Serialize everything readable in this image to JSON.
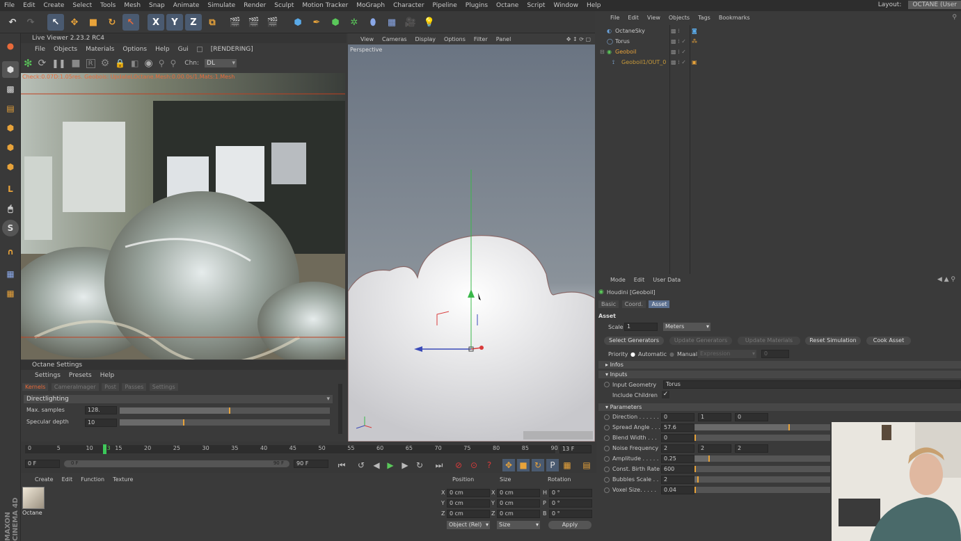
{
  "menu": [
    "File",
    "Edit",
    "Create",
    "Select",
    "Tools",
    "Mesh",
    "Snap",
    "Animate",
    "Simulate",
    "Render",
    "Sculpt",
    "Motion Tracker",
    "MoGraph",
    "Character",
    "Pipeline",
    "Plugins",
    "Octane",
    "Script",
    "Window",
    "Help"
  ],
  "layout": {
    "label": "Layout:",
    "value": "OCTANE (User"
  },
  "live_viewer": {
    "title": "Live Viewer 2.23.2 RC4",
    "menu": [
      "File",
      "Objects",
      "Materials",
      "Options",
      "Help",
      "Gui"
    ],
    "status": "[RENDERING]",
    "chn_label": "Chn:",
    "chn_value": "DL",
    "check_text": "Check:0.07D:1.05res. Geobois: UpdateLOctane.Mesh:0.00.0s/1.Mats:1.Mesh"
  },
  "octane_settings": {
    "title": "Octane Settings",
    "menu": [
      "Settings",
      "Presets",
      "Help"
    ],
    "tabs": [
      "Kernels",
      "CameraImager",
      "Post",
      "Passes",
      "Settings"
    ],
    "kernel": "Directlighting",
    "params": [
      {
        "label": "Max. samples",
        "value": "128.",
        "fill": 0.52
      },
      {
        "label": "Specular depth",
        "value": "10",
        "fill": 0.3
      }
    ]
  },
  "viewport": {
    "menu": [
      "View",
      "Cameras",
      "Display",
      "Options",
      "Filter",
      "Panel"
    ],
    "label": "Perspective"
  },
  "objects": {
    "menu": [
      "File",
      "Edit",
      "View",
      "Objects",
      "Tags",
      "Bookmarks"
    ],
    "rows": [
      {
        "name": "OctaneSky",
        "color": "#c8c8c8"
      },
      {
        "name": "Torus",
        "color": "#c8c8c8"
      },
      {
        "name": "Geoboil",
        "color": "#e8a33a"
      },
      {
        "name": "Geoboil1/OUT_0",
        "color": "#c89a3a"
      }
    ]
  },
  "attributes": {
    "menu": [
      "Mode",
      "Edit",
      "User Data"
    ],
    "title": "Houdini [Geoboil]",
    "tabs": [
      "Basic",
      "Coord.",
      "Asset"
    ],
    "section": "Asset",
    "scale_label": "Scale",
    "scale_value": "1",
    "unit": "Meters",
    "buttons": [
      "Select Generators",
      "Update Generators",
      "Update Materials",
      "Reset Simulation",
      "Cook Asset"
    ],
    "priority_label": "Priority",
    "priority_auto": "Automatic",
    "priority_manual": "Manual",
    "priority_expr": "Expression",
    "priority_num": "0",
    "infos": "Infos",
    "inputs": "Inputs",
    "input_geometry_label": "Input Geometry",
    "input_geometry_value": "Torus",
    "include_children": "Include Children",
    "parameters": "Parameters",
    "params": [
      {
        "label": "Direction . . . . . .",
        "values": [
          "0",
          "1",
          "0"
        ]
      },
      {
        "label": "Spread Angle . . .",
        "values": [
          "57.6"
        ],
        "fill": 0.69
      },
      {
        "label": "Blend Width . . .",
        "values": [
          "0"
        ],
        "fill": 0
      },
      {
        "label": "Noise Frequency",
        "values": [
          "2",
          "2",
          "2"
        ]
      },
      {
        "label": "Amplitude . . . . .",
        "values": [
          "0.25"
        ],
        "fill": 0.1
      },
      {
        "label": "Const. Birth Rate",
        "values": [
          "600"
        ],
        "fill": 0
      },
      {
        "label": "Bubbles Scale . .",
        "values": [
          "2"
        ],
        "fill": 0.02
      },
      {
        "label": "Voxel Size. . . . .",
        "values": [
          "0.04"
        ],
        "fill": 0
      }
    ]
  },
  "timeline": {
    "ticks": [
      "0",
      "5",
      "10",
      "13",
      "15",
      "20",
      "25",
      "30",
      "35",
      "40",
      "45",
      "50",
      "55",
      "60",
      "65",
      "70",
      "75",
      "80",
      "85",
      "90"
    ],
    "frame": "13 F",
    "start": "0 F",
    "range_start": "0 F",
    "range_end": "90 F",
    "end": "90 F"
  },
  "materials": {
    "menu": [
      "Create",
      "Edit",
      "Function",
      "Texture"
    ],
    "item": "Octane"
  },
  "coords": {
    "headers": [
      "Position",
      "Size",
      "Rotation"
    ],
    "rows": [
      {
        "a": "X",
        "pos": "0 cm",
        "b": "X",
        "size": "0 cm",
        "c": "H",
        "rot": "0 °"
      },
      {
        "a": "Y",
        "pos": "0 cm",
        "b": "Y",
        "size": "0 cm",
        "c": "P",
        "rot": "0 °"
      },
      {
        "a": "Z",
        "pos": "0 cm",
        "b": "Z",
        "size": "0 cm",
        "c": "B",
        "rot": "0 °"
      }
    ],
    "mode": "Object (Rel)",
    "size_mode": "Size",
    "apply": "Apply"
  },
  "brand": "MAXON CINEMA 4D"
}
